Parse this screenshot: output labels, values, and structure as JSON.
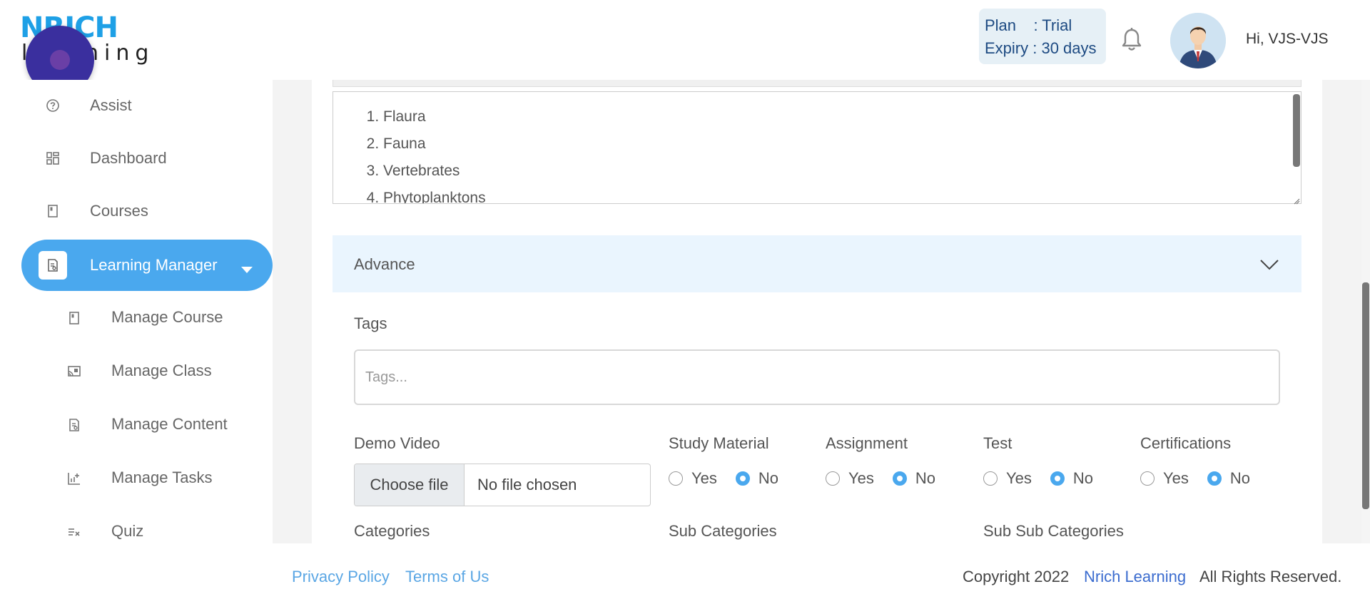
{
  "header": {
    "logo_top": "NRICH",
    "logo_bottom": "learning",
    "plan_line1": "Plan    : Trial",
    "plan_line2": "Expiry : 30 days",
    "greeting": "Hi, VJS-VJS"
  },
  "sidebar": {
    "items": [
      {
        "label": "Assist",
        "icon": "help-circle-icon"
      },
      {
        "label": "Dashboard",
        "icon": "dashboard-icon"
      },
      {
        "label": "Courses",
        "icon": "book-icon"
      },
      {
        "label": "Learning Manager",
        "icon": "document-icon",
        "active": true
      }
    ],
    "sub_items": [
      {
        "label": "Manage Course",
        "icon": "book-icon"
      },
      {
        "label": "Manage Class",
        "icon": "cast-icon"
      },
      {
        "label": "Manage Content",
        "icon": "document-icon"
      },
      {
        "label": "Manage Tasks",
        "icon": "chart-add-icon"
      },
      {
        "label": "Quiz",
        "icon": "list-check-icon"
      }
    ]
  },
  "list": {
    "items": [
      "Flaura",
      "Fauna",
      "Vertebrates",
      "Phytoplanktons"
    ]
  },
  "advance": {
    "label": "Advance"
  },
  "form": {
    "tags_label": "Tags",
    "tags_placeholder": "Tags...",
    "demo_video_label": "Demo Video",
    "choose_file": "Choose file",
    "no_file": "No file chosen",
    "study_material_label": "Study Material",
    "assignment_label": "Assignment",
    "test_label": "Test",
    "certifications_label": "Certifications",
    "yes": "Yes",
    "no": "No",
    "categories_label": "Categories",
    "sub_categories_label": "Sub Categories",
    "sub_sub_categories_label": "Sub Sub Categories"
  },
  "footer": {
    "privacy": "Privacy Policy",
    "terms": "Terms of Us",
    "copyright": "Copyright 2022",
    "brand": "Nrich Learning",
    "rights": "All Rights Reserved."
  },
  "colors": {
    "accent": "#4aa8ee",
    "advance_bg": "#eaf5fe",
    "plan_bg": "#e6f0f6",
    "link": "#5aa6e4"
  }
}
